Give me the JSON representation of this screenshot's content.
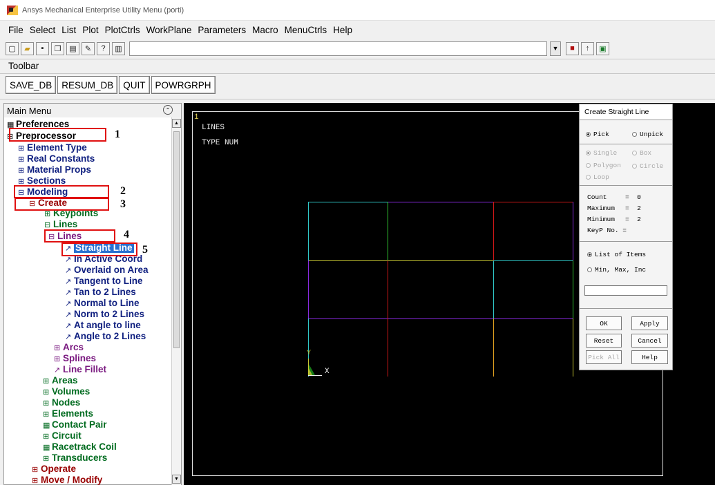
{
  "window": {
    "title": "Ansys Mechanical Enterprise Utility Menu (porti)"
  },
  "menubar": {
    "items": [
      "File",
      "Select",
      "List",
      "Plot",
      "PlotCtrls",
      "WorkPlane",
      "Parameters",
      "Macro",
      "MenuCtrls",
      "Help"
    ]
  },
  "iconbar": {
    "command_value": ""
  },
  "toolbar": {
    "label": "Toolbar",
    "buttons": [
      "SAVE_DB",
      "RESUM_DB",
      "QUIT",
      "POWRGRPH"
    ]
  },
  "main_menu": {
    "title": "Main Menu",
    "items": [
      {
        "label": "Preferences",
        "prefix": "▦"
      },
      {
        "label": "Preprocessor",
        "prefix": "⊟"
      },
      {
        "label": "Element Type",
        "prefix": "⊞"
      },
      {
        "label": "Real Constants",
        "prefix": "⊞"
      },
      {
        "label": "Material Props",
        "prefix": "⊞"
      },
      {
        "label": "Sections",
        "prefix": "⊞"
      },
      {
        "label": "Modeling",
        "prefix": "⊟"
      },
      {
        "label": "Create",
        "prefix": "⊟"
      },
      {
        "label": "Keypoints",
        "prefix": "⊞"
      },
      {
        "label": "Lines",
        "prefix": "⊟"
      },
      {
        "label": "Lines",
        "prefix": "⊟"
      },
      {
        "label": "Straight Line",
        "prefix": "↗"
      },
      {
        "label": "In Active Coord",
        "prefix": "↗"
      },
      {
        "label": "Overlaid on Area",
        "prefix": "↗"
      },
      {
        "label": "Tangent to Line",
        "prefix": "↗"
      },
      {
        "label": "Tan to 2 Lines",
        "prefix": "↗"
      },
      {
        "label": "Normal to Line",
        "prefix": "↗"
      },
      {
        "label": "Norm to 2 Lines",
        "prefix": "↗"
      },
      {
        "label": "At angle to line",
        "prefix": "↗"
      },
      {
        "label": "Angle to 2 Lines",
        "prefix": "↗"
      },
      {
        "label": "Arcs",
        "prefix": "⊞"
      },
      {
        "label": "Splines",
        "prefix": "⊞"
      },
      {
        "label": "Line Fillet",
        "prefix": "↗"
      },
      {
        "label": "Areas",
        "prefix": "⊞"
      },
      {
        "label": "Volumes",
        "prefix": "⊞"
      },
      {
        "label": "Nodes",
        "prefix": "⊞"
      },
      {
        "label": "Elements",
        "prefix": "⊞"
      },
      {
        "label": "Contact Pair",
        "prefix": "▦"
      },
      {
        "label": "Circuit",
        "prefix": "⊞"
      },
      {
        "label": "Racetrack Coil",
        "prefix": "▦"
      },
      {
        "label": "Transducers",
        "prefix": "⊞"
      },
      {
        "label": "Operate",
        "prefix": "⊞"
      },
      {
        "label": "Move / Modify",
        "prefix": "⊞"
      }
    ]
  },
  "callouts": [
    "1",
    "2",
    "3",
    "4",
    "5"
  ],
  "graphics": {
    "window_number": "1",
    "line1": "LINES",
    "line2": "TYPE NUM",
    "axis_x": "X",
    "axis_y": "Y"
  },
  "dialog": {
    "title": "Create Straight Line",
    "pick": "Pick",
    "unpick": "Unpick",
    "single": "Single",
    "box": "Box",
    "polygon": "Polygon",
    "circle": "Circle",
    "loop": "Loop",
    "count_label": "Count",
    "count_value": "0",
    "maximum_label": "Maximum",
    "maximum_value": "2",
    "minimum_label": "Minimum",
    "minimum_value": "2",
    "keyp_label": "KeyP No. =",
    "list_of_items": "List of Items",
    "min_max_inc": "Min, Max, Inc",
    "input_value": "",
    "ok": "OK",
    "apply": "Apply",
    "reset": "Reset",
    "cancel": "Cancel",
    "pick_all": "Pick All",
    "help": "Help"
  }
}
